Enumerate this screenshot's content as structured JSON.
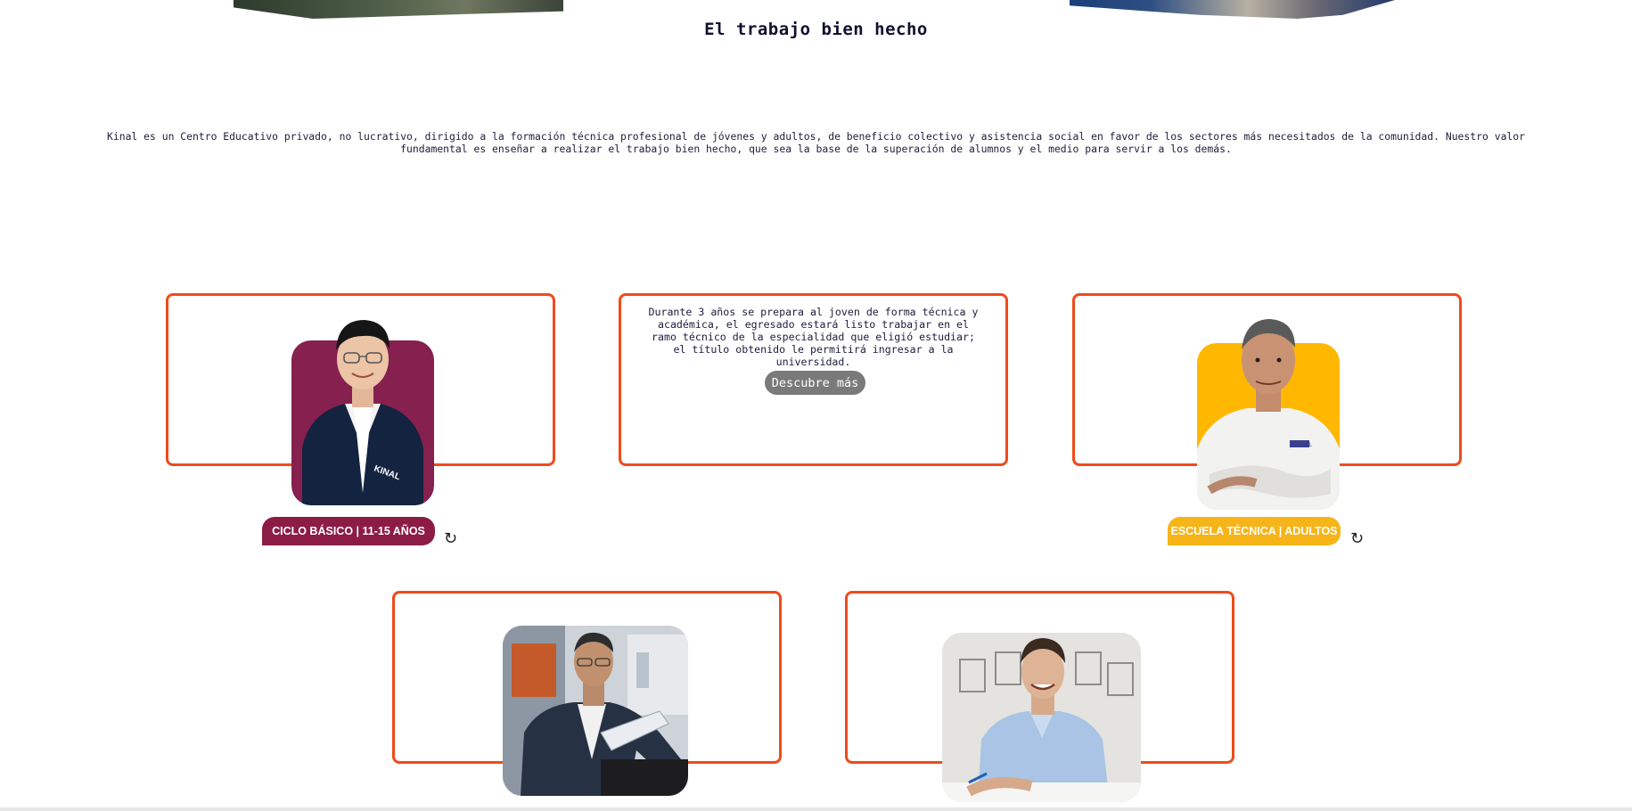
{
  "section": {
    "title": "El trabajo bien hecho",
    "intro": "Kinal es un Centro Educativo privado, no lucrativo, dirigido a la formación técnica profesional de jóvenes y adultos, de beneficio colectivo y asistencia social en favor de los sectores más necesitados de la comunidad. Nuestro valor fundamental es enseñar a realizar el trabajo bien hecho, que sea la base de la superación de alumnos y el medio para servir a los demás."
  },
  "cards": {
    "basico": {
      "tag": "CICLO BÁSICO | 11-15 AÑOS",
      "tag_color": "#8c1c45",
      "portrait_bg": "#86204e",
      "flip_icon": "rotate-icon"
    },
    "diversificado": {
      "text": "Durante 3 años se prepara al joven de forma técnica y académica, el egresado estará listo trabajar en el ramo técnico de la especialidad que eligió estudiar; el título obtenido le permitirá ingresar a la universidad.",
      "button": "Descubre más"
    },
    "adultos": {
      "tag": "ESCUELA TÉCNICA | ADULTOS",
      "tag_color": "#f6b418",
      "portrait_bg": "#ffb700",
      "flip_icon": "rotate-icon"
    },
    "card4": {},
    "card5": {}
  },
  "icons": {
    "flip": "↻"
  },
  "colors": {
    "card_border": "#ef4b1c",
    "button_bg": "#7a7a7a"
  }
}
